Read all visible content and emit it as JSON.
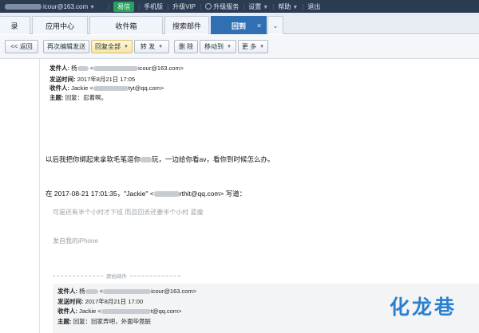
{
  "topbar": {
    "account_suffix": "icour@163.com",
    "yixin": "易信",
    "items": [
      "手机版",
      "升级VIP",
      "升级服务",
      "设置",
      "帮助",
      "退出"
    ]
  },
  "tabs": [
    {
      "label": "录",
      "active": false
    },
    {
      "label": "应用中心",
      "active": false
    },
    {
      "label": "收件箱",
      "active": false
    },
    {
      "label": "搜索邮件",
      "active": false
    },
    {
      "label": "回到",
      "active": true
    }
  ],
  "toolbar": {
    "back": "<< 返回",
    "resend": "再次编辑发送",
    "reply_all": "回复全部",
    "forward": "转 发",
    "delete": "删 除",
    "move": "移动到",
    "more": "更 多"
  },
  "header": {
    "from_label": "发件人:",
    "from_value": "杨",
    "from_email": "icour@163.com",
    "date_label": "发送时间:",
    "date_value": "2017年8月21日 17:05",
    "to_label": "收件人:",
    "to_value": "Jackie <",
    "to_email": "tyt@qq.com>",
    "subject_label": "主题:",
    "subject_value": "回复：忍着啊。"
  },
  "body": {
    "line1_a": "以后我把你绑起来拿软毛笔逗你",
    "line1_b": "玩，一边给你看av，看你到时候怎么办。",
    "quote_intro_a": "在 2017-08-21 17:01:35，\"Jackie\" <",
    "quote_intro_b": "rthit@qq.com> 写道：",
    "quote_line1": "可是还有半个小时才下班 而且回去还要半个小时 蓝瘦",
    "quote_line2": "发自我的iPhone"
  },
  "original": {
    "divider_label": "原始邮件",
    "from_label": "发件人:",
    "from_value": "杨",
    "from_email": "icour@163.com>",
    "date_label": "发送时间:",
    "date_value": "2017年8月21日 17:00",
    "to_label": "收件人:",
    "to_value": "Jackie <",
    "to_email": "t@qq.com>",
    "subject_label": "主题:",
    "subject_value": "回复：回家弄吧，外面毕竟脏"
  },
  "watermark": "化龙巷"
}
